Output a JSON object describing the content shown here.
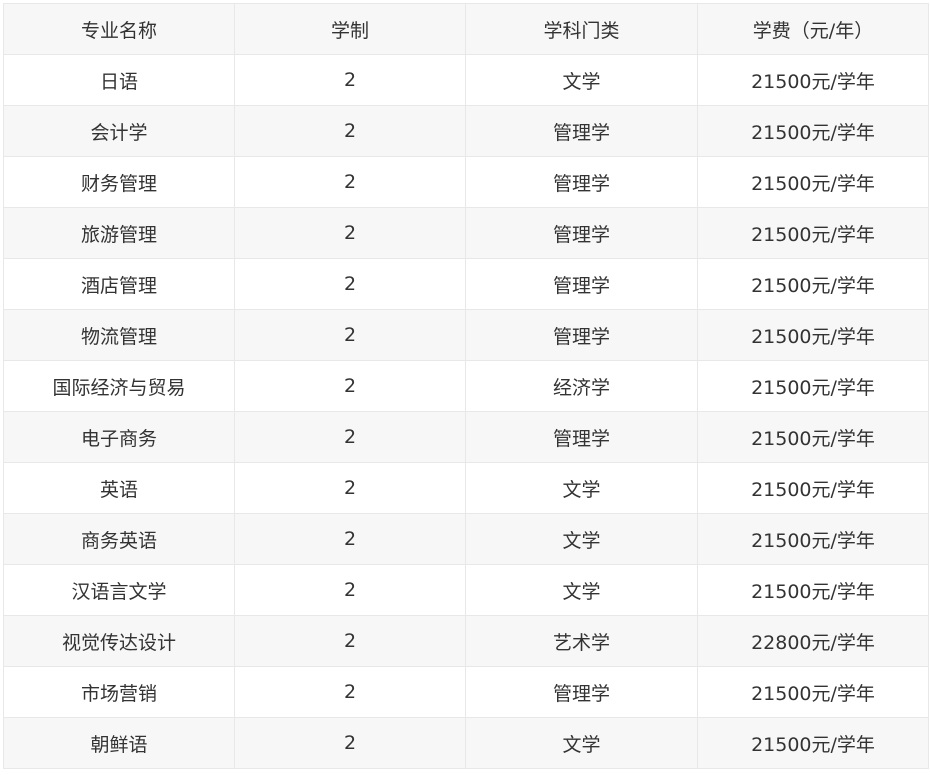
{
  "table": {
    "headers": [
      "专业名称",
      "学制",
      "学科门类",
      "学费（元/年）"
    ],
    "rows": [
      [
        "日语",
        "2",
        "文学",
        "21500元/学年"
      ],
      [
        "会计学",
        "2",
        "管理学",
        "21500元/学年"
      ],
      [
        "财务管理",
        "2",
        "管理学",
        "21500元/学年"
      ],
      [
        "旅游管理",
        "2",
        "管理学",
        "21500元/学年"
      ],
      [
        "酒店管理",
        "2",
        "管理学",
        "21500元/学年"
      ],
      [
        "物流管理",
        "2",
        "管理学",
        "21500元/学年"
      ],
      [
        "国际经济与贸易",
        "2",
        "经济学",
        "21500元/学年"
      ],
      [
        "电子商务",
        "2",
        "管理学",
        "21500元/学年"
      ],
      [
        "英语",
        "2",
        "文学",
        "21500元/学年"
      ],
      [
        "商务英语",
        "2",
        "文学",
        "21500元/学年"
      ],
      [
        "汉语言文学",
        "2",
        "文学",
        "21500元/学年"
      ],
      [
        "视觉传达设计",
        "2",
        "艺术学",
        "22800元/学年"
      ],
      [
        "市场营销",
        "2",
        "管理学",
        "21500元/学年"
      ],
      [
        "朝鲜语",
        "2",
        "文学",
        "21500元/学年"
      ]
    ]
  },
  "colors": {
    "header_bg": "#f7f7f7",
    "stripe_bg": "#f7f7f7",
    "border": "#e8e8e8",
    "text": "#333333"
  }
}
